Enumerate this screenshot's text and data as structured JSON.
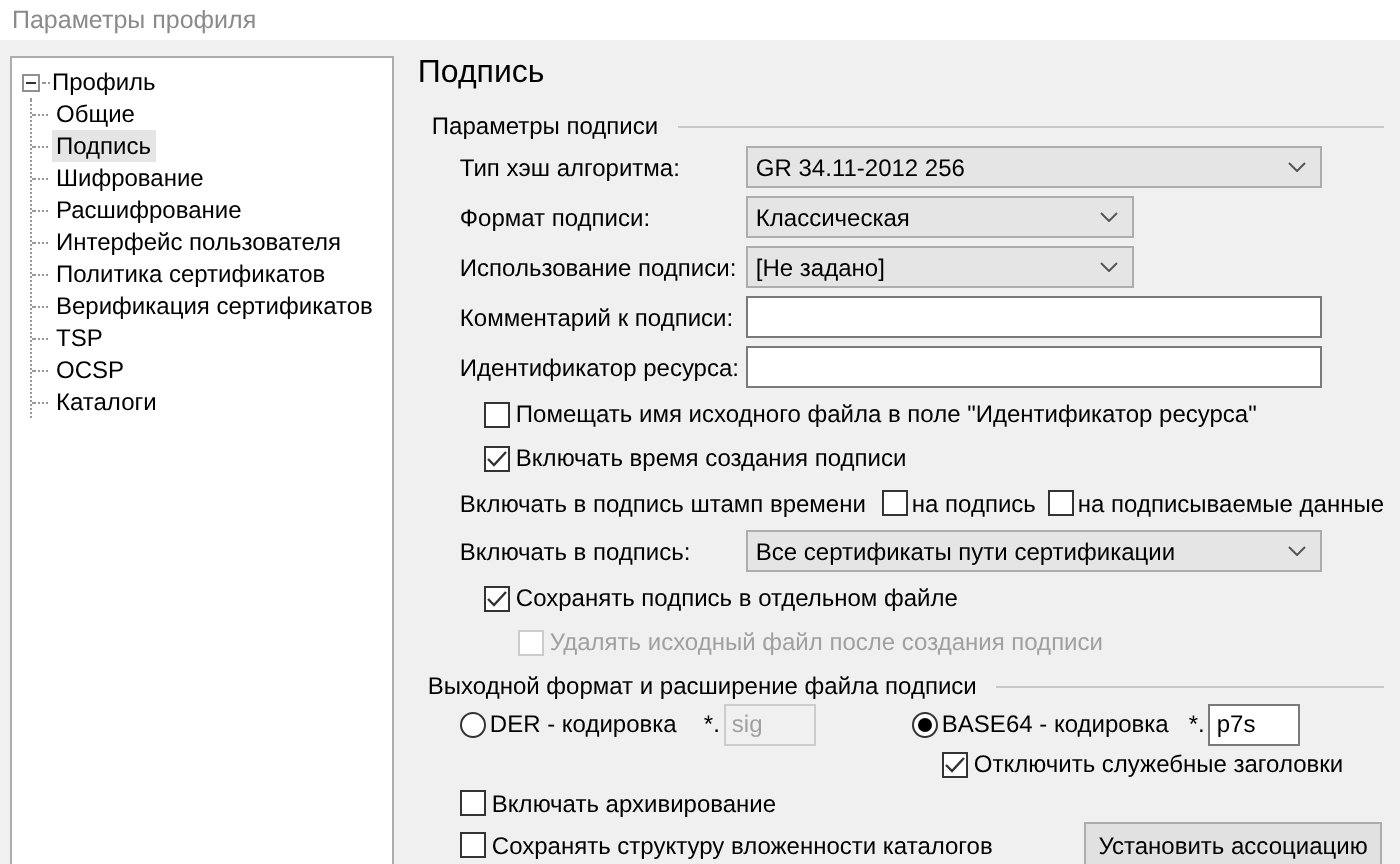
{
  "window": {
    "title": "Параметры профиля"
  },
  "tree": {
    "label": "Профиль",
    "expanded": true,
    "children": [
      {
        "label": "Общие",
        "selected": false
      },
      {
        "label": "Подпись",
        "selected": true
      },
      {
        "label": "Шифрование",
        "selected": false
      },
      {
        "label": "Расшифрование",
        "selected": false
      },
      {
        "label": "Интерфейс пользователя",
        "selected": false
      },
      {
        "label": "Политика сертификатов",
        "selected": false
      },
      {
        "label": "Верификация сертификатов",
        "selected": false
      },
      {
        "label": "TSP",
        "selected": false
      },
      {
        "label": "OCSP",
        "selected": false
      },
      {
        "label": "Каталоги",
        "selected": false
      }
    ]
  },
  "heading": "Подпись",
  "signature_params": {
    "title": "Параметры подписи",
    "rows": [
      {
        "kind": "combo",
        "label": "Тип хэш алгоритма:",
        "value": "GR 34.11-2012 256",
        "wide": true
      },
      {
        "kind": "combo",
        "label": "Формат подписи:",
        "value": "Классическая",
        "wide": false
      },
      {
        "kind": "combo",
        "label": "Использование подписи:",
        "value": "[Не задано]",
        "wide": false
      },
      {
        "kind": "field",
        "label": "Комментарий к подписи:"
      },
      {
        "kind": "field",
        "label": "Идентификатор ресурса:"
      },
      {
        "kind": "check",
        "label": "Помещать имя исходного файла в поле \"Идентификатор ресурса\"",
        "checked": false,
        "disabled": false
      },
      {
        "kind": "check",
        "label": "Включать время создания подписи",
        "checked": true,
        "disabled": false
      },
      {
        "kind": "stamp",
        "label": "Включать в подпись штамп времени",
        "options": [
          {
            "label": "на подпись",
            "checked": false
          },
          {
            "label": "на подписываемые данные",
            "checked": false
          }
        ]
      },
      {
        "kind": "combo",
        "label": "Включать в подпись:",
        "value": "Все сертификаты пути сертификации",
        "wide": true
      },
      {
        "kind": "check",
        "label": "Сохранять подпись в отдельном файле",
        "checked": true,
        "disabled": false
      },
      {
        "kind": "check",
        "label": "Удалять исходный файл после создания подписи",
        "checked": false,
        "disabled": true
      }
    ]
  },
  "output": {
    "title": "Выходной формат и расширение файла подписи",
    "formats": [
      {
        "label": "DER - кодировка",
        "prefix": "*.",
        "ext": "sig",
        "selected": false
      },
      {
        "label": "BASE64 - кодировка",
        "prefix": "*.",
        "ext": "p7s",
        "selected": true
      }
    ],
    "no_headers": {
      "label": "Отключить служебные заголовки",
      "checked": true
    },
    "archive": {
      "label": "Включать архивирование",
      "checked": false
    },
    "keep_structure": {
      "label": "Сохранять структуру вложенности каталогов",
      "checked": false
    },
    "button": "Установить ассоциацию"
  }
}
